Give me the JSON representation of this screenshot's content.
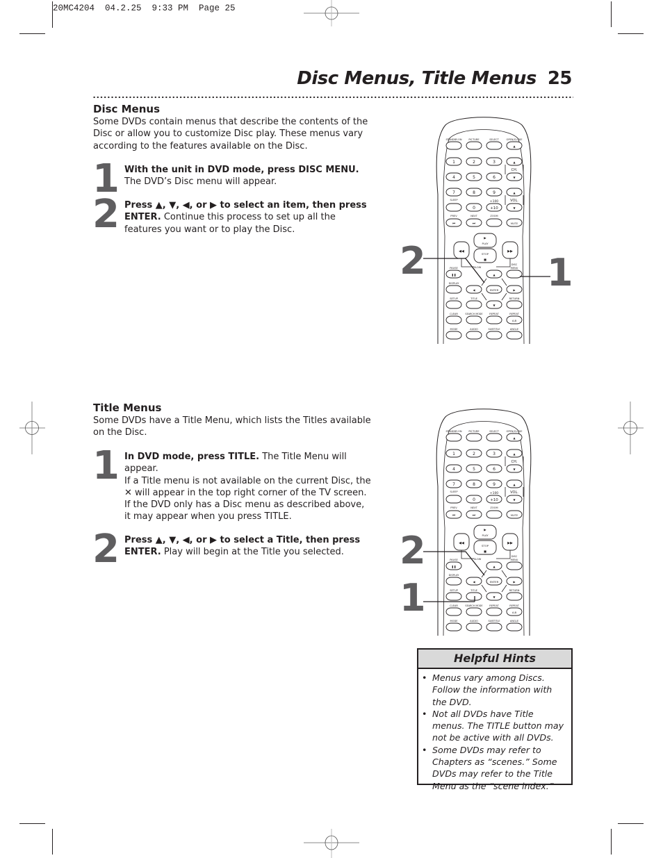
{
  "slug": "20MC4204  04.2.25  9:33 PM  Page 25",
  "header": {
    "title": "Disc Menus, Title Menus",
    "page_number": "25"
  },
  "disc_menus": {
    "heading": "Disc Menus",
    "intro_lines": [
      "Some DVDs contain menus that describe the contents of the",
      "Disc or allow you to customize Disc play. These menus vary",
      "according to the features available on the Disc."
    ],
    "steps": [
      {
        "number": "1",
        "bold": "With the unit in DVD mode, press DISC MENU.",
        "text": " The DVD’s Disc menu will appear."
      },
      {
        "number": "2",
        "bold": "Press ▲, ▼, ◀, or ▶ to select an item, then press ENTER.",
        "text": " Continue this process to set up all the features you want or to play the Disc."
      }
    ],
    "callouts": {
      "left": "2",
      "right": "1"
    }
  },
  "title_menus": {
    "heading": "Title Menus",
    "intro_lines": [
      "Some DVDs have a Title Menu, which lists the Titles available",
      "on the Disc."
    ],
    "steps": [
      {
        "number": "1",
        "bold": "In DVD mode, press TITLE.",
        "text": " The Title Menu will appear.",
        "extra": "If a Title menu is not available on the current Disc, the ✕ will appear in the top right corner of the TV screen. If the DVD only has a Disc menu as described above, it may appear when you press TITLE."
      },
      {
        "number": "2",
        "bold": "Press ▲, ▼, ◀, or ▶ to select a Title, then press ENTER.",
        "text": " Play will begin at the Title you selected."
      }
    ],
    "callouts": {
      "upper": "2",
      "lower": "1"
    }
  },
  "remote": {
    "labels": {
      "standby": "STANDBY-ON",
      "picture": "PICTURE",
      "select": "SELECT",
      "open_close": "OPEN/CLOSE",
      "ch": "CH.",
      "vol": "VOL.",
      "sleep": "SLEEP",
      "plus100": "+100",
      "plus10": "+10",
      "prev": "PREV",
      "next": "NEXT",
      "zoom": "ZOOM",
      "mute": "MUTE",
      "play": "PLAY",
      "stop": "STOP",
      "slow": "SLOW",
      "pause": "PAUSE",
      "disc_menu_1": "DISC",
      "disc_menu_2": "MENU",
      "display": "DISPLAY",
      "enter": "ENTER",
      "setup": "SETUP",
      "title": "TITLE",
      "return": "RETURN",
      "clear": "CLEAR",
      "search_mode": "SEARCH MODE",
      "repeat": "REPEAT",
      "repeat_ab_label": "REPEAT",
      "ab": "A-B",
      "mode": "MODE",
      "audio": "AUDIO",
      "subtitle": "SUBTITLE",
      "angle": "ANGLE"
    },
    "digits": [
      "1",
      "2",
      "3",
      "4",
      "5",
      "6",
      "7",
      "8",
      "9",
      "0"
    ]
  },
  "helpful_hints": {
    "heading": "Helpful Hints",
    "items": [
      "Menus vary among Discs. Follow the information with the DVD.",
      "Not all DVDs have Title menus. The TITLE button may not be active with all DVDs.",
      "Some DVDs may refer to Chapters as “scenes.” Some DVDs may refer to the Title Menu as the “scene index.”"
    ]
  }
}
